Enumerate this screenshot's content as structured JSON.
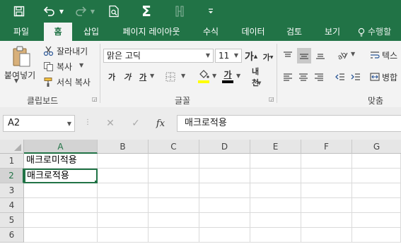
{
  "quick_access": {
    "save_icon": "save-icon",
    "undo_icon": "undo-icon",
    "redo_icon": "redo-icon",
    "print_preview_icon": "print-preview-icon",
    "autosum_symbol": "Σ",
    "customize_icon": "customize-dropdown-icon"
  },
  "tabs": [
    {
      "label": "파일",
      "active": false
    },
    {
      "label": "홈",
      "active": true
    },
    {
      "label": "삽입",
      "active": false
    },
    {
      "label": "페이지 레이아웃",
      "active": false
    },
    {
      "label": "수식",
      "active": false
    },
    {
      "label": "데이터",
      "active": false
    },
    {
      "label": "검토",
      "active": false
    },
    {
      "label": "보기",
      "active": false
    }
  ],
  "tell_me": "수행할",
  "clipboard": {
    "group_label": "클립보드",
    "paste_label": "붙여넣기",
    "cut_label": "잘라내기",
    "copy_label": "복사",
    "format_painter_label": "서식 복사"
  },
  "font": {
    "group_label": "글꼴",
    "font_name": "맑은 고딕",
    "font_size": "11",
    "grow_glyph": "가",
    "shrink_glyph": "가",
    "bold_glyph": "가",
    "italic_glyph": "가",
    "underline_glyph": "가",
    "font_color_glyph": "가",
    "phonetic_glyph": "내천",
    "highlight_color": "#ffff00",
    "font_color": "#000000"
  },
  "alignment": {
    "group_label": "맞춤",
    "wrap_text_label": "텍스",
    "merge_label": "병합"
  },
  "formula_bar": {
    "name_box": "A2",
    "cancel_symbol": "✕",
    "enter_symbol": "✓",
    "fx_symbol": "fx",
    "content": "매크로적용"
  },
  "sheet": {
    "columns": [
      "A",
      "B",
      "C",
      "D",
      "E",
      "F",
      "G"
    ],
    "rows": [
      "1",
      "2",
      "3",
      "4",
      "5",
      "6"
    ],
    "cells": {
      "A1": "매크로미적용",
      "A2": "매크로적용"
    },
    "selected_cell": "A2"
  },
  "colors": {
    "accent": "#217346",
    "ribbon_bg": "#f3f3f3"
  }
}
